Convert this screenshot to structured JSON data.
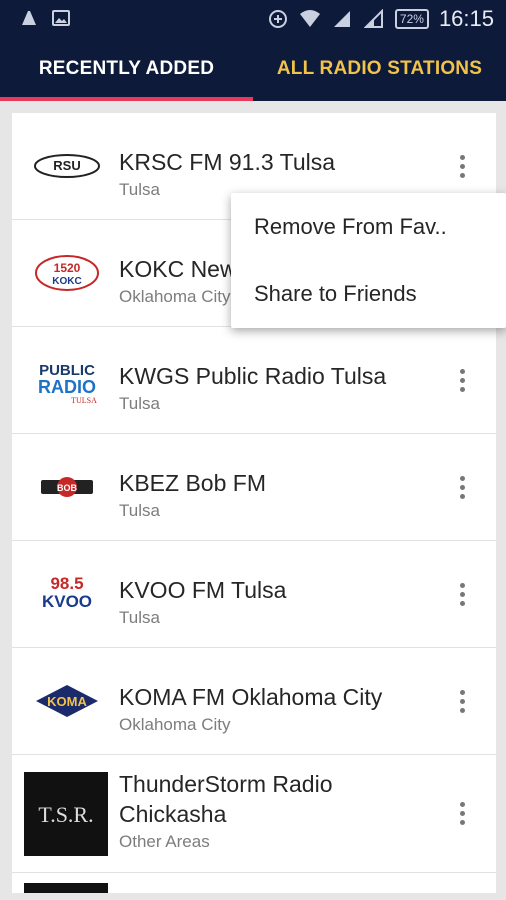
{
  "status_bar": {
    "time": "16:15",
    "battery": "72%"
  },
  "tabs": [
    {
      "label": "RECENTLY ADDED",
      "selected": true
    },
    {
      "label": "ALL RADIO STATIONS",
      "selected": false
    }
  ],
  "colors": {
    "appbar": "#0d1a3a",
    "active_tab_text": "#ffffff",
    "inactive_tab_text": "#f2c349",
    "indicator": "#e8385b"
  },
  "stations": [
    {
      "name": "KRSC FM 91.3 Tulsa",
      "location": "Tulsa",
      "logo": "RSU"
    },
    {
      "name": "KOKC News Talk",
      "location": "Oklahoma City",
      "logo": "1520 KOKC"
    },
    {
      "name": "KWGS Public Radio Tulsa",
      "location": "Tulsa",
      "logo": "PUBLIC RADIO"
    },
    {
      "name": "KBEZ Bob FM",
      "location": "Tulsa",
      "logo": "BOB FM"
    },
    {
      "name": "KVOO FM Tulsa",
      "location": "Tulsa",
      "logo": "98.5 KVOO"
    },
    {
      "name": "KOMA FM Oklahoma City",
      "location": "Oklahoma City",
      "logo": "92.5 KOMA"
    },
    {
      "name": "ThunderStorm Radio Chickasha",
      "location": "Other Areas",
      "logo": "T.S.R."
    }
  ],
  "popup_menu": {
    "items": [
      "Remove From Fav..",
      "Share to Friends"
    ]
  }
}
